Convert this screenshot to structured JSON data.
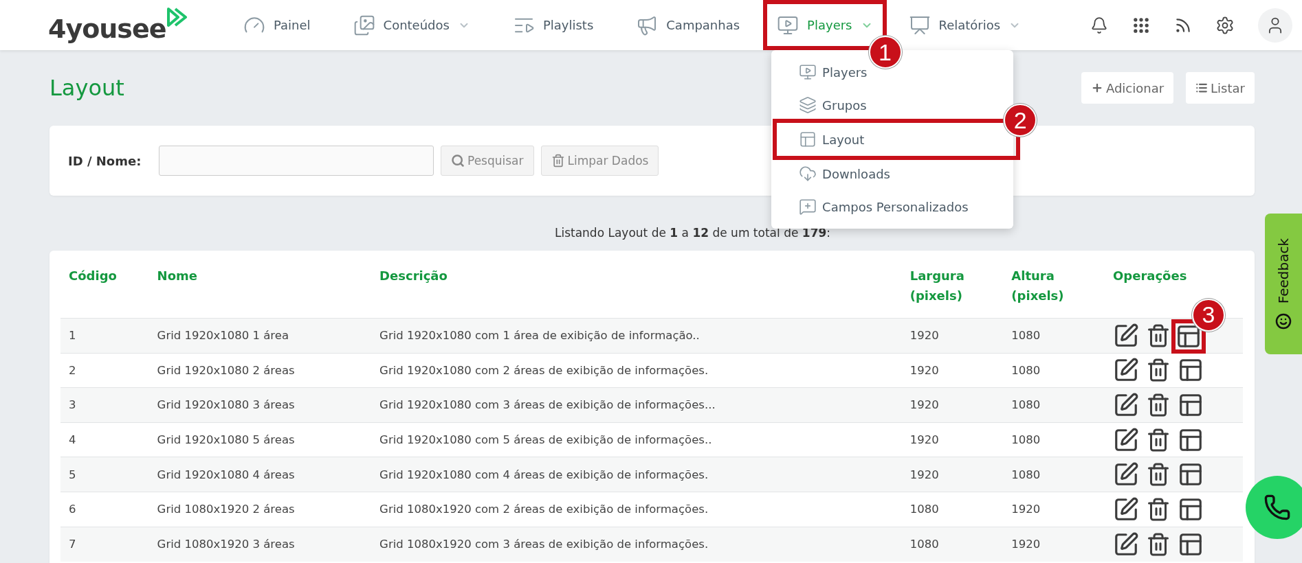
{
  "nav": {
    "logo": "4yousee",
    "items": [
      {
        "label": "Painel",
        "selected": false,
        "caret": false
      },
      {
        "label": "Conteúdos",
        "selected": false,
        "caret": true
      },
      {
        "label": "Playlists",
        "selected": false,
        "caret": false
      },
      {
        "label": "Campanhas",
        "selected": false,
        "caret": false
      },
      {
        "label": "Players",
        "selected": true,
        "caret": true,
        "annotation": "1"
      },
      {
        "label": "Relatórios",
        "selected": false,
        "caret": true
      }
    ]
  },
  "dropdown": {
    "items": [
      {
        "label": "Players"
      },
      {
        "label": "Grupos"
      },
      {
        "label": "Layout",
        "annotation": "2"
      },
      {
        "label": "Downloads"
      },
      {
        "label": "Campos Personalizados"
      }
    ]
  },
  "page": {
    "title": "Layout",
    "actions": [
      "Adicionar",
      "Listar"
    ]
  },
  "filter": {
    "label": "ID / Nome:",
    "search_button": "Pesquisar",
    "clear_button": "Limpar Dados"
  },
  "listing": "Listando Layout de **1** a **12** de um total de **179**:",
  "table": {
    "columns": [
      "Código",
      "Nome",
      "Descrição",
      "Largura (pixels)",
      "Altura (pixels)",
      "Operações"
    ],
    "rows": [
      {
        "cells": [
          "1",
          "Grid 1920x1080 1 área",
          "Grid 1920x1080 com 1 área de exibição de informação..",
          "1920",
          "1080"
        ],
        "annotation": "3"
      },
      {
        "cells": [
          "2",
          "Grid 1920x1080 2 áreas",
          "Grid 1920x1080 com 2 áreas de exibição de informações.",
          "1920",
          "1080"
        ]
      },
      {
        "cells": [
          "3",
          "Grid 1920x1080 3 áreas",
          "Grid 1920x1080 com 3 áreas de exibição de informações...",
          "1920",
          "1080"
        ]
      },
      {
        "cells": [
          "4",
          "Grid 1920x1080 5 áreas",
          "Grid 1920x1080 com 5 áreas de exibição de informações..",
          "1920",
          "1080"
        ]
      },
      {
        "cells": [
          "5",
          "Grid 1920x1080 4 áreas",
          "Grid 1920x1080 com 4 áreas de exibição de informações.",
          "1920",
          "1080"
        ]
      },
      {
        "cells": [
          "6",
          "Grid 1080x1920 2 áreas",
          "Grid 1080x1920 com 2 áreas de exibição de informações.",
          "1080",
          "1920"
        ]
      },
      {
        "cells": [
          "7",
          "Grid 1080x1920 3 áreas",
          "Grid 1080x1920 com 3 áreas de exibição de informações.",
          "1080",
          "1920"
        ]
      }
    ]
  },
  "feedback": "Feedback"
}
